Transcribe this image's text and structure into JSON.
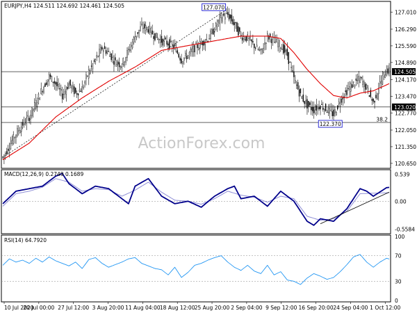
{
  "colors": {
    "background": "#ffffff",
    "candle": "#000000",
    "ma": "#e00000",
    "macd": "#00008b",
    "signal": "#8e8ed6",
    "rsi": "#2196f3",
    "box_border": "#0000cc",
    "watermark": "#c8c8c8"
  },
  "chart_data": [
    {
      "type": "candlestick",
      "title": "EURJPY,H4  124.511 124.692 124.461 124.505",
      "symbol": "EURJPY,H4",
      "ohlc": {
        "open": 124.511,
        "high": 124.692,
        "low": 124.461,
        "close": 124.505
      },
      "y_ticks": [
        "127.010",
        "126.290",
        "125.590",
        "124.890",
        "124.170",
        "123.470",
        "122.770",
        "122.050",
        "121.350",
        "120.650"
      ],
      "ylim": [
        120.5,
        127.4
      ],
      "x_ticks": [
        "10 Jul 2020",
        "20 Jul 00:00",
        "27 Jul 12:00",
        "3 Aug 20:00",
        "11 Aug 04:00",
        "18 Aug 12:00",
        "25 Aug 20:00",
        "2 Sep 04:00",
        "9 Sep 12:00",
        "16 Sep 20:00",
        "24 Sep 04:00",
        "1 Oct 12:00"
      ],
      "price_path": [
        [
          0,
          120.9
        ],
        [
          5,
          121.4
        ],
        [
          10,
          121.9
        ],
        [
          15,
          122.3
        ],
        [
          20,
          122.6
        ],
        [
          25,
          123.2
        ],
        [
          30,
          123.8
        ],
        [
          35,
          124.3
        ],
        [
          40,
          124.0
        ],
        [
          45,
          123.5
        ],
        [
          50,
          124.0
        ],
        [
          55,
          123.6
        ],
        [
          60,
          123.8
        ],
        [
          65,
          124.5
        ],
        [
          70,
          125.0
        ],
        [
          75,
          125.5
        ],
        [
          80,
          125.3
        ],
        [
          85,
          124.9
        ],
        [
          90,
          124.8
        ],
        [
          95,
          125.4
        ],
        [
          100,
          126.0
        ],
        [
          105,
          126.4
        ],
        [
          110,
          126.3
        ],
        [
          115,
          126.0
        ],
        [
          120,
          125.8
        ],
        [
          125,
          125.7
        ],
        [
          130,
          125.5
        ],
        [
          135,
          125.0
        ],
        [
          140,
          125.2
        ],
        [
          145,
          125.5
        ],
        [
          150,
          125.7
        ],
        [
          155,
          125.9
        ],
        [
          160,
          126.3
        ],
        [
          165,
          126.8
        ],
        [
          170,
          126.9
        ],
        [
          175,
          126.5
        ],
        [
          180,
          126.0
        ],
        [
          185,
          125.9
        ],
        [
          190,
          125.6
        ],
        [
          195,
          125.3
        ],
        [
          200,
          126.0
        ],
        [
          205,
          125.8
        ],
        [
          210,
          125.6
        ],
        [
          215,
          125.2
        ],
        [
          220,
          124.2
        ],
        [
          225,
          123.5
        ],
        [
          230,
          123.1
        ],
        [
          235,
          122.9
        ],
        [
          240,
          123.1
        ],
        [
          245,
          122.9
        ],
        [
          250,
          122.7
        ],
        [
          255,
          123.3
        ],
        [
          260,
          123.7
        ],
        [
          265,
          124.0
        ],
        [
          270,
          124.2
        ],
        [
          275,
          123.8
        ],
        [
          280,
          123.2
        ],
        [
          285,
          124.0
        ],
        [
          290,
          124.6
        ],
        [
          292,
          124.505
        ]
      ],
      "moving_average": [
        [
          0,
          120.8
        ],
        [
          20,
          121.5
        ],
        [
          40,
          122.6
        ],
        [
          60,
          123.4
        ],
        [
          80,
          124.1
        ],
        [
          100,
          124.7
        ],
        [
          120,
          125.4
        ],
        [
          140,
          125.6
        ],
        [
          160,
          125.8
        ],
        [
          180,
          126.0
        ],
        [
          200,
          126.0
        ],
        [
          210,
          125.9
        ],
        [
          220,
          125.3
        ],
        [
          230,
          124.6
        ],
        [
          240,
          124.0
        ],
        [
          250,
          123.5
        ],
        [
          260,
          123.4
        ],
        [
          270,
          123.6
        ],
        [
          280,
          123.7
        ],
        [
          292,
          124.0
        ]
      ],
      "horizontal_lines": [
        124.505,
        123.02,
        122.37
      ],
      "trendline": [
        [
          0,
          120.9
        ],
        [
          168,
          127.07
        ]
      ],
      "annotations": [
        {
          "text": "127.070",
          "value": 127.07
        },
        {
          "text": "122.370",
          "value": 122.37
        },
        {
          "text": "38.2",
          "value": 122.37
        }
      ],
      "price_labels": [
        {
          "text": "124.505",
          "value": 124.505
        },
        {
          "text": "123.020",
          "value": 123.02
        }
      ],
      "watermark": "ActionForex.com"
    },
    {
      "type": "line",
      "title": "MACD(12,26,9) 0.2749 0.1689",
      "y_ticks": [
        "0.539",
        "0.00",
        "-0.5584"
      ],
      "ylim": [
        -0.62,
        0.6
      ],
      "series": [
        {
          "name": "MACD",
          "values": [
            [
              0,
              -0.05
            ],
            [
              10,
              0.2
            ],
            [
              20,
              0.25
            ],
            [
              30,
              0.3
            ],
            [
              40,
              0.5
            ],
            [
              45,
              0.55
            ],
            [
              50,
              0.35
            ],
            [
              60,
              0.15
            ],
            [
              70,
              0.3
            ],
            [
              80,
              0.25
            ],
            [
              90,
              0.05
            ],
            [
              95,
              -0.05
            ],
            [
              100,
              0.3
            ],
            [
              110,
              0.45
            ],
            [
              120,
              0.1
            ],
            [
              130,
              -0.05
            ],
            [
              140,
              0.0
            ],
            [
              150,
              -0.12
            ],
            [
              160,
              0.1
            ],
            [
              170,
              0.25
            ],
            [
              175,
              0.3
            ],
            [
              180,
              0.05
            ],
            [
              190,
              0.1
            ],
            [
              200,
              -0.1
            ],
            [
              210,
              0.2
            ],
            [
              220,
              0.0
            ],
            [
              230,
              -0.4
            ],
            [
              235,
              -0.48
            ],
            [
              240,
              -0.35
            ],
            [
              250,
              -0.4
            ],
            [
              260,
              -0.15
            ],
            [
              270,
              0.25
            ],
            [
              275,
              0.2
            ],
            [
              280,
              0.1
            ],
            [
              290,
              0.27
            ],
            [
              292,
              0.2749
            ]
          ]
        },
        {
          "name": "Signal",
          "values": [
            [
              0,
              -0.1
            ],
            [
              10,
              0.15
            ],
            [
              20,
              0.2
            ],
            [
              30,
              0.28
            ],
            [
              40,
              0.45
            ],
            [
              50,
              0.38
            ],
            [
              60,
              0.2
            ],
            [
              70,
              0.25
            ],
            [
              80,
              0.23
            ],
            [
              90,
              0.1
            ],
            [
              100,
              0.22
            ],
            [
              110,
              0.38
            ],
            [
              120,
              0.18
            ],
            [
              130,
              0.02
            ],
            [
              140,
              0.0
            ],
            [
              150,
              -0.06
            ],
            [
              160,
              0.05
            ],
            [
              170,
              0.2
            ],
            [
              180,
              0.12
            ],
            [
              190,
              0.08
            ],
            [
              200,
              -0.02
            ],
            [
              210,
              0.1
            ],
            [
              220,
              0.05
            ],
            [
              230,
              -0.3
            ],
            [
              240,
              -0.38
            ],
            [
              250,
              -0.35
            ],
            [
              260,
              -0.2
            ],
            [
              270,
              0.15
            ],
            [
              280,
              0.16
            ],
            [
              292,
              0.1689
            ]
          ]
        }
      ],
      "trendline": [
        [
          240,
          -0.45
        ],
        [
          292,
          0.18
        ]
      ]
    },
    {
      "type": "line",
      "title": "RSI(14) 64.7920",
      "y_ticks": [
        "100",
        "70",
        "30",
        "0"
      ],
      "ylim": [
        0,
        100
      ],
      "series": [
        {
          "name": "RSI",
          "values": [
            [
              0,
              55
            ],
            [
              5,
              65
            ],
            [
              10,
              60
            ],
            [
              15,
              63
            ],
            [
              20,
              58
            ],
            [
              25,
              66
            ],
            [
              30,
              60
            ],
            [
              35,
              68
            ],
            [
              40,
              62
            ],
            [
              45,
              58
            ],
            [
              50,
              54
            ],
            [
              55,
              60
            ],
            [
              60,
              50
            ],
            [
              65,
              64
            ],
            [
              70,
              67
            ],
            [
              75,
              58
            ],
            [
              80,
              52
            ],
            [
              85,
              56
            ],
            [
              90,
              60
            ],
            [
              95,
              65
            ],
            [
              100,
              67
            ],
            [
              105,
              58
            ],
            [
              110,
              54
            ],
            [
              115,
              50
            ],
            [
              120,
              48
            ],
            [
              125,
              40
            ],
            [
              130,
              52
            ],
            [
              135,
              36
            ],
            [
              140,
              44
            ],
            [
              145,
              55
            ],
            [
              150,
              58
            ],
            [
              155,
              63
            ],
            [
              160,
              67
            ],
            [
              165,
              70
            ],
            [
              170,
              60
            ],
            [
              175,
              52
            ],
            [
              180,
              47
            ],
            [
              185,
              55
            ],
            [
              190,
              46
            ],
            [
              195,
              42
            ],
            [
              200,
              55
            ],
            [
              205,
              40
            ],
            [
              210,
              45
            ],
            [
              215,
              32
            ],
            [
              220,
              30
            ],
            [
              225,
              25
            ],
            [
              230,
              35
            ],
            [
              235,
              42
            ],
            [
              240,
              38
            ],
            [
              245,
              33
            ],
            [
              250,
              36
            ],
            [
              255,
              45
            ],
            [
              260,
              56
            ],
            [
              265,
              68
            ],
            [
              270,
              72
            ],
            [
              275,
              60
            ],
            [
              280,
              52
            ],
            [
              285,
              60
            ],
            [
              290,
              66
            ],
            [
              292,
              64.79
            ]
          ]
        }
      ]
    }
  ]
}
